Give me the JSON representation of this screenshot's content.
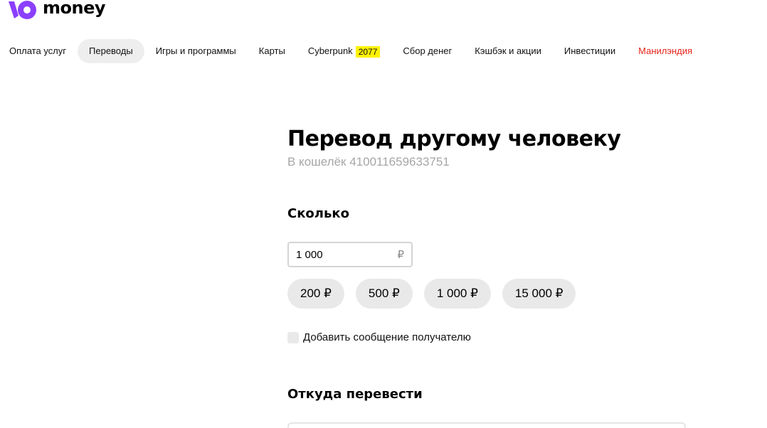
{
  "logo": {
    "text": "money",
    "brand_color": "#8B3FFD"
  },
  "nav": {
    "items": [
      {
        "label": "Оплата услуг"
      },
      {
        "label": "Переводы"
      },
      {
        "label": "Игры и программы"
      },
      {
        "label": "Карты"
      },
      {
        "label": "Cyberpunk",
        "badge": "2077"
      },
      {
        "label": "Сбор денег"
      },
      {
        "label": "Кэшбэк и акции"
      },
      {
        "label": "Инвестиции"
      },
      {
        "label": "Манилэндия"
      }
    ],
    "active_index": 1,
    "accent_color": "#E7251C",
    "badge_color": "#FFF200"
  },
  "page": {
    "title": "Перевод другому человеку",
    "subtitle": "В кошелёк 410011659633751"
  },
  "amount_section": {
    "title": "Сколько",
    "input_value": "1 000",
    "currency": "₽",
    "presets": [
      "200 ₽",
      "500 ₽",
      "1 000 ₽",
      "15 000 ₽"
    ]
  },
  "message": {
    "label": "Добавить сообщение получателю",
    "checked": false
  },
  "source_section": {
    "title": "Откуда перевести"
  }
}
